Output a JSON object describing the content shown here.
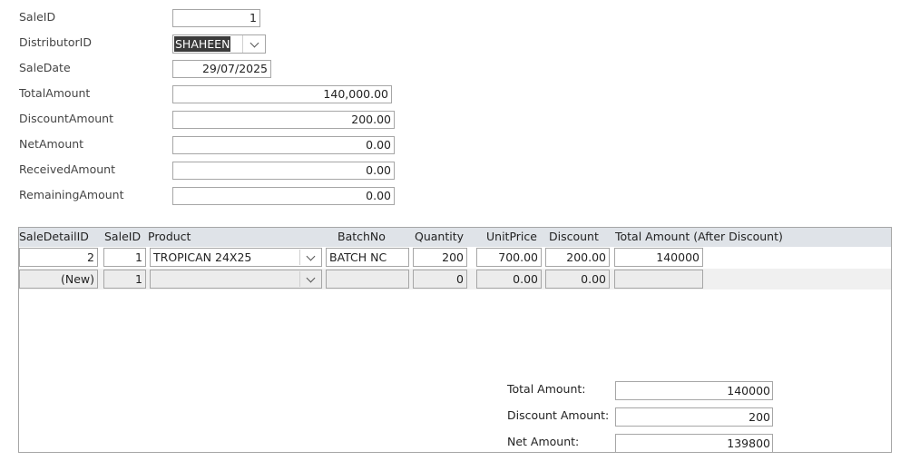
{
  "form": {
    "labels": {
      "sale_id": "SaleID",
      "distributor_id": "DistributorID",
      "sale_date": "SaleDate",
      "total_amount": "TotalAmount",
      "discount_amount": "DiscountAmount",
      "net_amount": "NetAmount",
      "received_amount": "ReceivedAmount",
      "remaining_amount": "RemainingAmount"
    },
    "values": {
      "sale_id": "1",
      "distributor_id": "SHAHEEN",
      "sale_date": "29/07/2025",
      "total_amount": "140,000.00",
      "discount_amount": "200.00",
      "net_amount": "0.00",
      "received_amount": "0.00",
      "remaining_amount": "0.00"
    }
  },
  "subform": {
    "columns": {
      "sale_detail_id": "SaleDetailID",
      "sale_id": "SaleID",
      "product": "Product",
      "batch_no": "BatchNo",
      "quantity": "Quantity",
      "unit_price": "UnitPrice",
      "discount": "Discount",
      "total_after_discount": "Total Amount (After Discount)"
    },
    "rows": [
      {
        "sale_detail_id": "2",
        "sale_id": "1",
        "product": "TROPICAN 24X25",
        "batch_no": "BATCH NC",
        "quantity": "200",
        "unit_price": "700.00",
        "discount": "200.00",
        "total_after_discount": "140000"
      },
      {
        "sale_detail_id": "(New)",
        "sale_id": "1",
        "product": "",
        "batch_no": "",
        "quantity": "0",
        "unit_price": "0.00",
        "discount": "0.00",
        "total_after_discount": ""
      }
    ],
    "totals": {
      "total_amount_label": "Total Amount:",
      "total_amount_value": "140000",
      "discount_amount_label": "Discount Amount:",
      "discount_amount_value": "200",
      "net_amount_label": "Net Amount:",
      "net_amount_value": "139800"
    }
  },
  "icons": {
    "dropdown": "chevron-down-icon"
  }
}
